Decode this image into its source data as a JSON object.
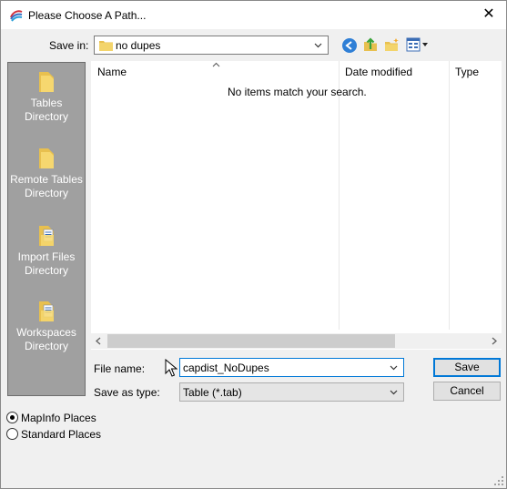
{
  "window": {
    "title": "Please Choose A Path..."
  },
  "toolbar": {
    "save_in_label": "Save in:",
    "save_in_value": "no dupes"
  },
  "places": [
    {
      "label": "Tables Directory"
    },
    {
      "label": "Remote Tables Directory"
    },
    {
      "label": "Import Files Directory"
    },
    {
      "label": "Workspaces Directory"
    }
  ],
  "filelist": {
    "columns": [
      "Name",
      "Date modified",
      "Type"
    ],
    "empty_message": "No items match your search."
  },
  "form": {
    "file_name_label": "File name:",
    "file_name_value": "capdist_NoDupes",
    "save_as_type_label": "Save as type:",
    "save_as_type_value": "Table (*.tab)"
  },
  "buttons": {
    "save": "Save",
    "cancel": "Cancel"
  },
  "radios": [
    {
      "label": "MapInfo Places",
      "checked": true
    },
    {
      "label": "Standard Places",
      "checked": false
    }
  ]
}
